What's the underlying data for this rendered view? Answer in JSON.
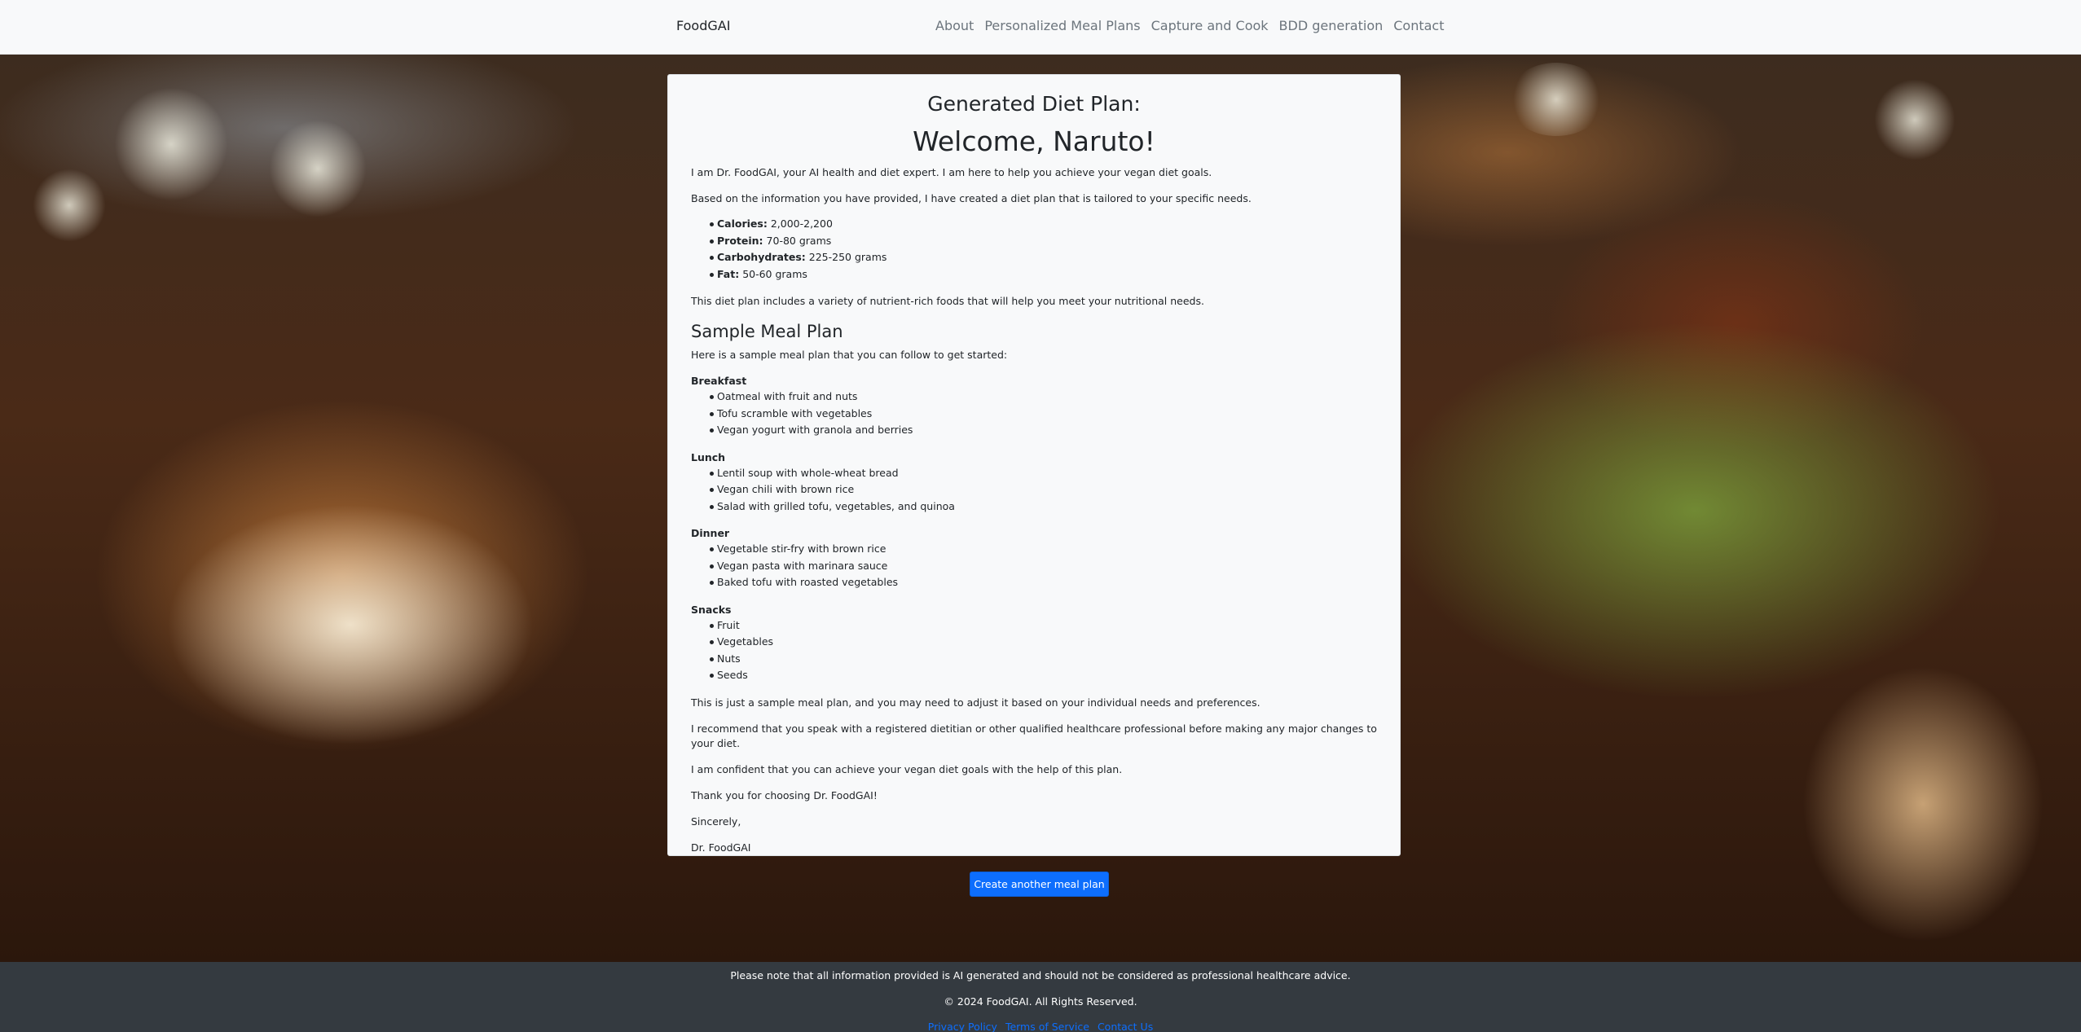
{
  "navbar": {
    "brand": "FoodGAI",
    "links": [
      "About",
      "Personalized Meal Plans",
      "Capture and Cook",
      "BDD generation",
      "Contact"
    ]
  },
  "card": {
    "heading": "Generated Diet Plan:",
    "welcome": "Welcome, Naruto!",
    "intro": "I am Dr. FoodGAI, your AI health and diet expert. I am here to help you achieve your vegan diet goals.",
    "basis": "Based on the information you have provided, I have created a diet plan that is tailored to your specific needs.",
    "macros": [
      {
        "label": "Calories:",
        "value": " 2,000-2,200"
      },
      {
        "label": "Protein:",
        "value": " 70-80 grams"
      },
      {
        "label": "Carbohydrates:",
        "value": " 225-250 grams"
      },
      {
        "label": "Fat:",
        "value": " 50-60 grams"
      }
    ],
    "variety": "This diet plan includes a variety of nutrient-rich foods that will help you meet your nutritional needs.",
    "sample_title": "Sample Meal Plan",
    "sample_intro": "Here is a sample meal plan that you can follow to get started:",
    "meals": [
      {
        "name": "Breakfast",
        "items": [
          "Oatmeal with fruit and nuts",
          "Tofu scramble with vegetables",
          "Vegan yogurt with granola and berries"
        ]
      },
      {
        "name": "Lunch",
        "items": [
          "Lentil soup with whole-wheat bread",
          "Vegan chili with brown rice",
          "Salad with grilled tofu, vegetables, and quinoa"
        ]
      },
      {
        "name": "Dinner",
        "items": [
          "Vegetable stir-fry with brown rice",
          "Vegan pasta with marinara sauce",
          "Baked tofu with roasted vegetables"
        ]
      },
      {
        "name": "Snacks",
        "items": [
          "Fruit",
          "Vegetables",
          "Nuts",
          "Seeds"
        ]
      }
    ],
    "closing": [
      "This is just a sample meal plan, and you may need to adjust it based on your individual needs and preferences.",
      "I recommend that you speak with a registered dietitian or other qualified healthcare professional before making any major changes to your diet.",
      "I am confident that you can achieve your vegan diet goals with the help of this plan.",
      "Thank you for choosing Dr. FoodGAI!",
      "Sincerely,",
      "Dr. FoodGAI"
    ]
  },
  "cta": {
    "label": "Create another meal plan"
  },
  "footer": {
    "note": "Please note that all information provided is AI generated and should not be considered as professional healthcare advice.",
    "copyright": "© 2024 FoodGAI. All Rights Reserved.",
    "links": [
      "Privacy Policy",
      "Terms of Service",
      "Contact Us"
    ]
  },
  "colors": {
    "navbar_bg": "#f8f9fa",
    "card_bg": "#f8f9fa",
    "button_primary": "#0d6efd",
    "footer_bg": "#343a40",
    "footer_link": "#0d6efd"
  }
}
